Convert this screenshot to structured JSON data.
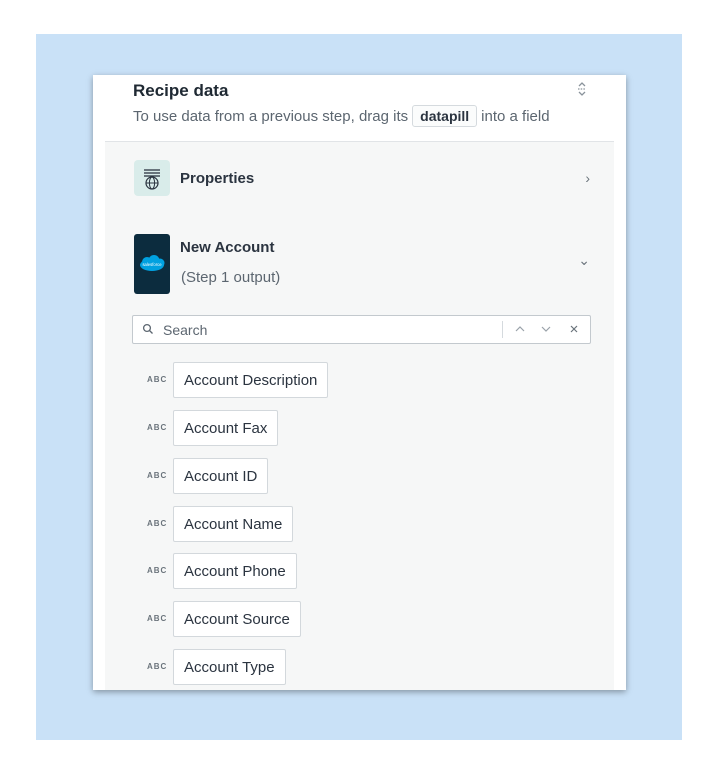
{
  "header": {
    "title": "Recipe data",
    "subtitle_before": "To use data from a previous step, drag its",
    "pill": "datapill",
    "subtitle_after": "into a field"
  },
  "properties": {
    "label": "Properties",
    "icon": "list-globe-icon"
  },
  "step": {
    "title": "New Account",
    "subtitle": "(Step 1 output)",
    "icon": "salesforce-logo",
    "logo_text": "salesforce"
  },
  "search": {
    "placeholder": "Search",
    "value": ""
  },
  "fields": [
    {
      "type": "ABC",
      "label": "Account Description"
    },
    {
      "type": "ABC",
      "label": "Account Fax"
    },
    {
      "type": "ABC",
      "label": "Account ID"
    },
    {
      "type": "ABC",
      "label": "Account Name"
    },
    {
      "type": "ABC",
      "label": "Account Phone"
    },
    {
      "type": "ABC",
      "label": "Account Source"
    },
    {
      "type": "ABC",
      "label": "Account Type"
    }
  ],
  "colors": {
    "backdrop": "#c9e1f7",
    "salesforce_tile": "#0c2c3e",
    "salesforce_cloud": "#00a1e0",
    "properties_tile": "#d9ecea"
  }
}
